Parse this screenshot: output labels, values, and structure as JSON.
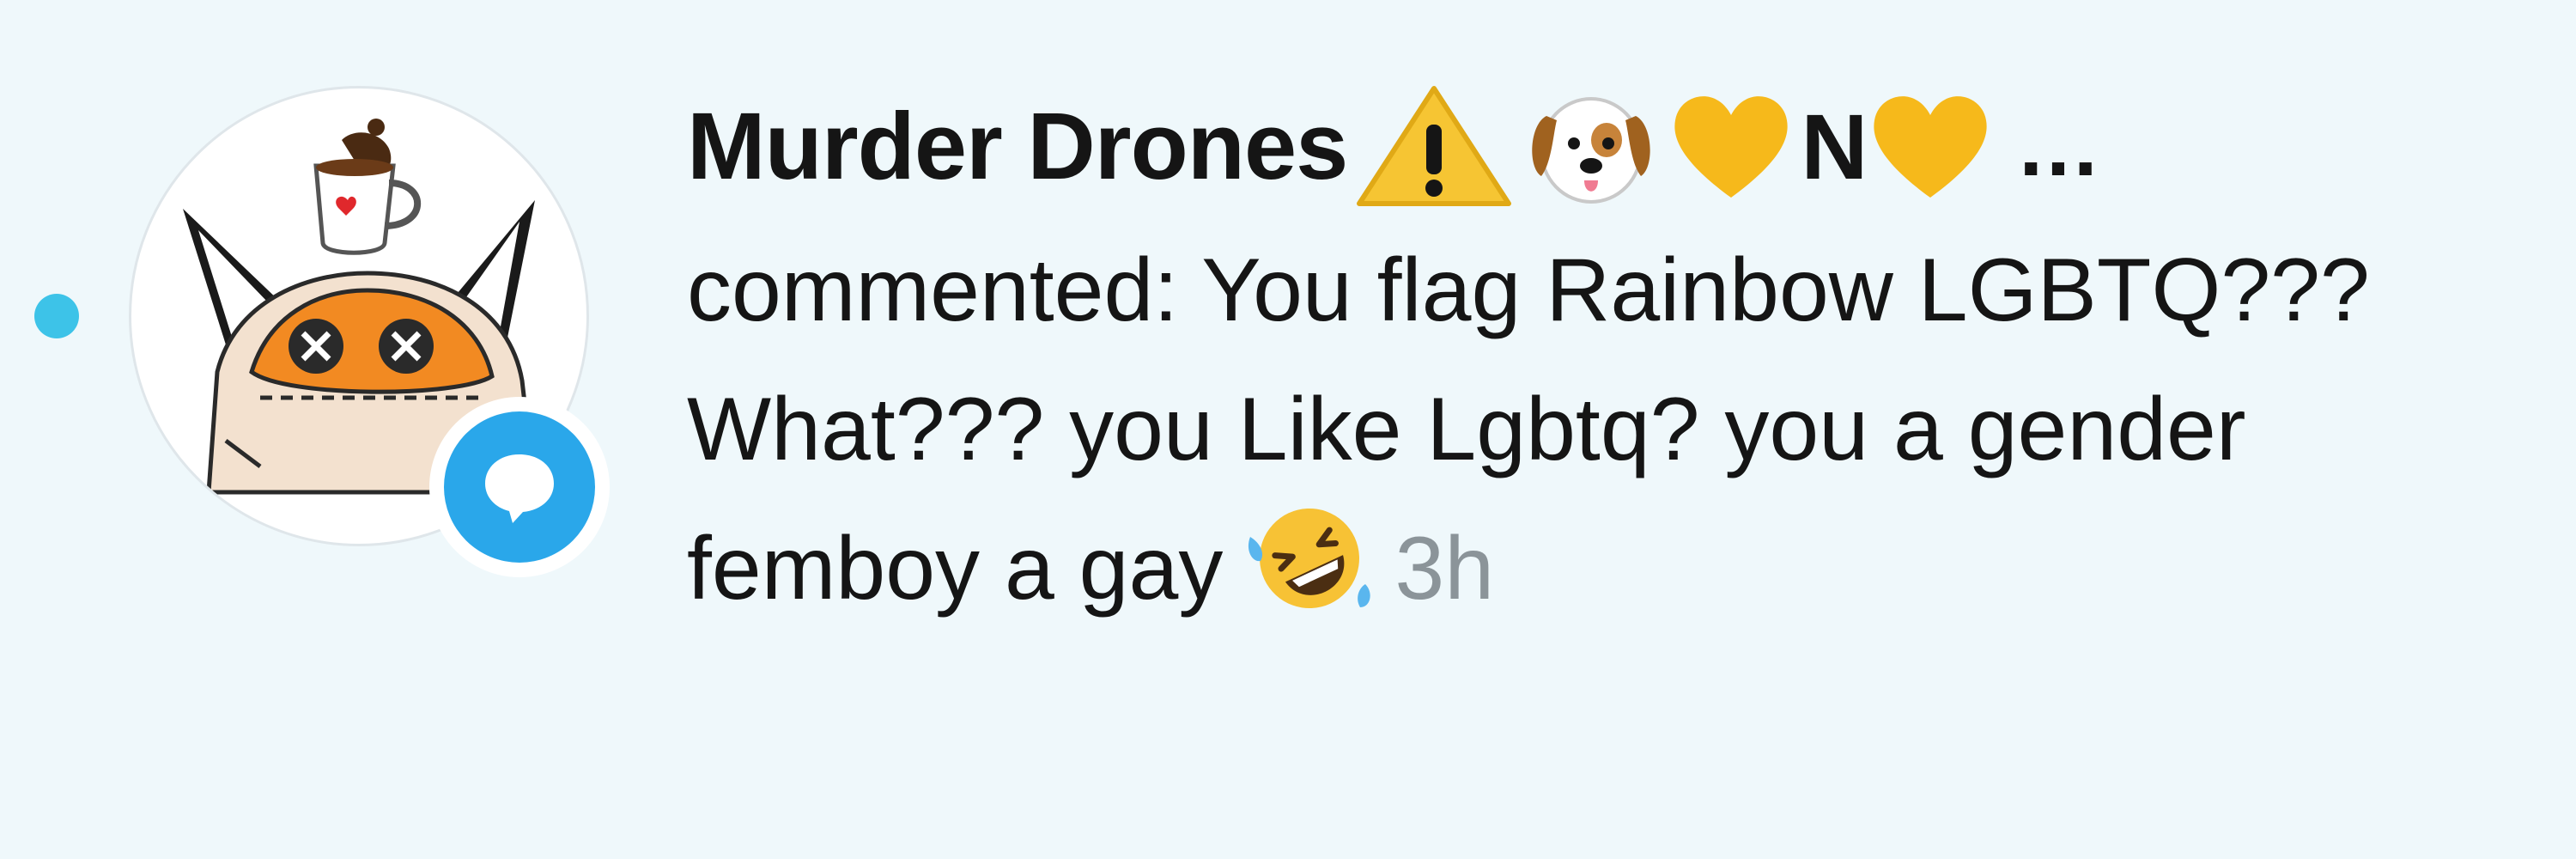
{
  "notification": {
    "author": "Murder Drones",
    "badge_emojis": [
      "warning-sign",
      "dog-face",
      "yellow-heart",
      "yellow-heart"
    ],
    "badge_letter": "N",
    "truncation": "...",
    "comment_text": "commented: You flag Rainbow LGBTQ??? What??? you Like Lgbtq? you a gender femboy a gay",
    "comment_emoji": "rolling-on-floor-laughing",
    "time": "3h",
    "unread": true,
    "type_icon": "comment-bubble-icon"
  },
  "colors": {
    "background": "#eff8fb",
    "unread_dot": "#3dc3e8",
    "badge_blue": "#2aa7ea",
    "text": "#151515",
    "muted": "#8b9499"
  }
}
